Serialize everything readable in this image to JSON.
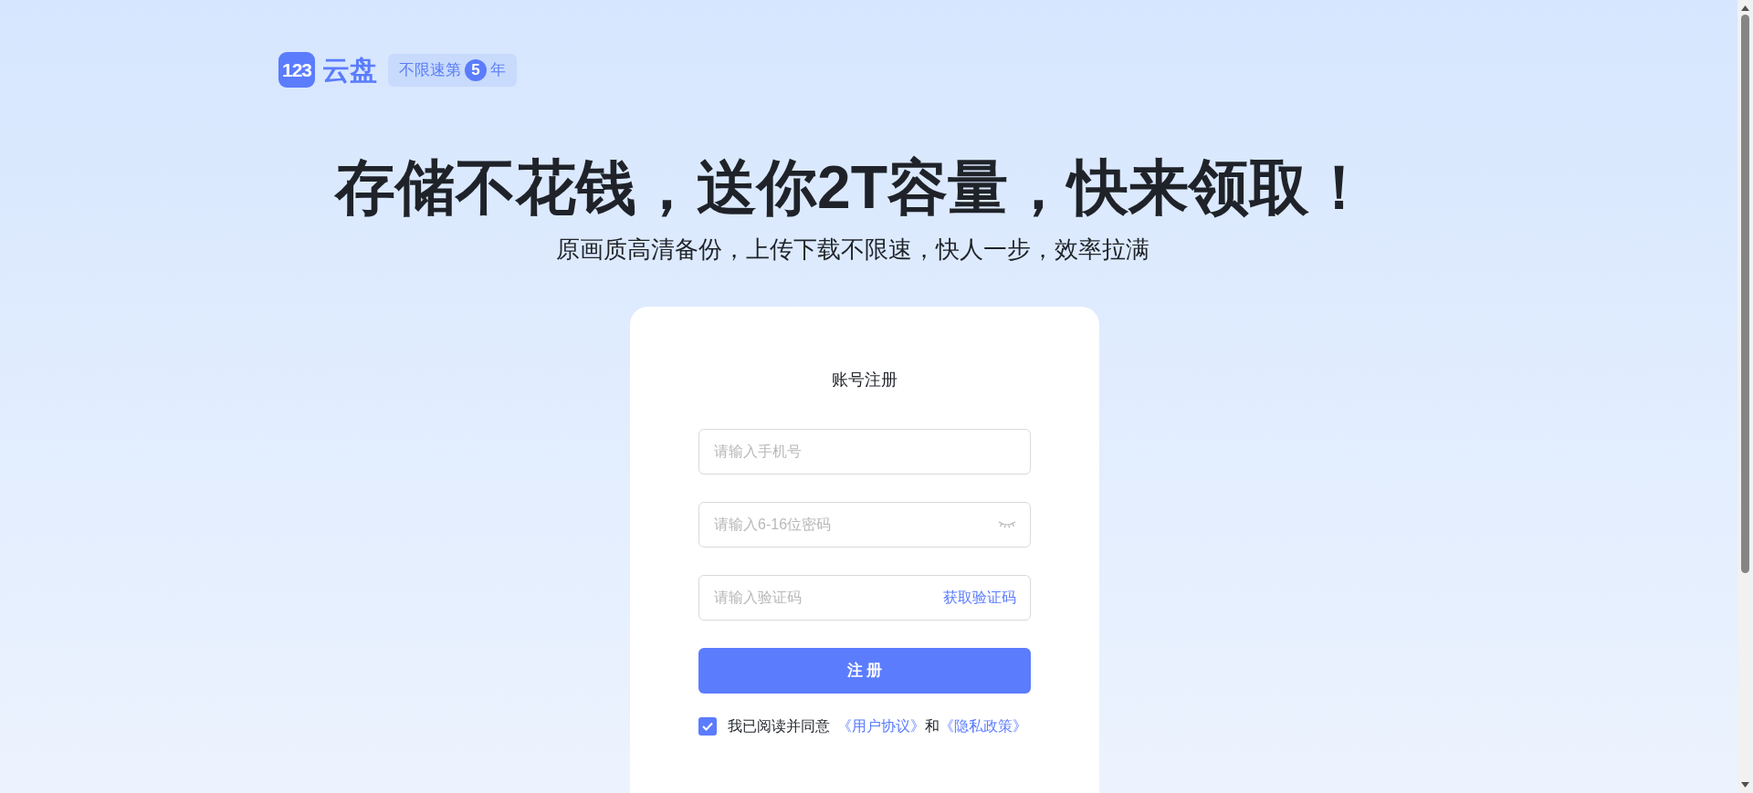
{
  "logo": {
    "mark": "123",
    "name": "云盘"
  },
  "badge": {
    "before": "不限速第",
    "number": "5",
    "after": "年"
  },
  "headline": "存储不花钱，送你2T容量，快来领取！",
  "subtitle": "原画质高清备份，上传下载不限速，快人一步，效率拉满",
  "form": {
    "title": "账号注册",
    "fields": [
      {
        "kind": "text",
        "placeholder": "请输入手机号"
      },
      {
        "kind": "password",
        "placeholder": "请输入6-16位密码"
      },
      {
        "kind": "code",
        "placeholder": "请输入验证码",
        "action": "获取验证码"
      }
    ],
    "submit": "注 册",
    "agreement": {
      "checked": true,
      "text": "我已阅读并同意",
      "link_1": "《用户协议》",
      "joiner": "和",
      "link_2": "《隐私政策》"
    }
  }
}
